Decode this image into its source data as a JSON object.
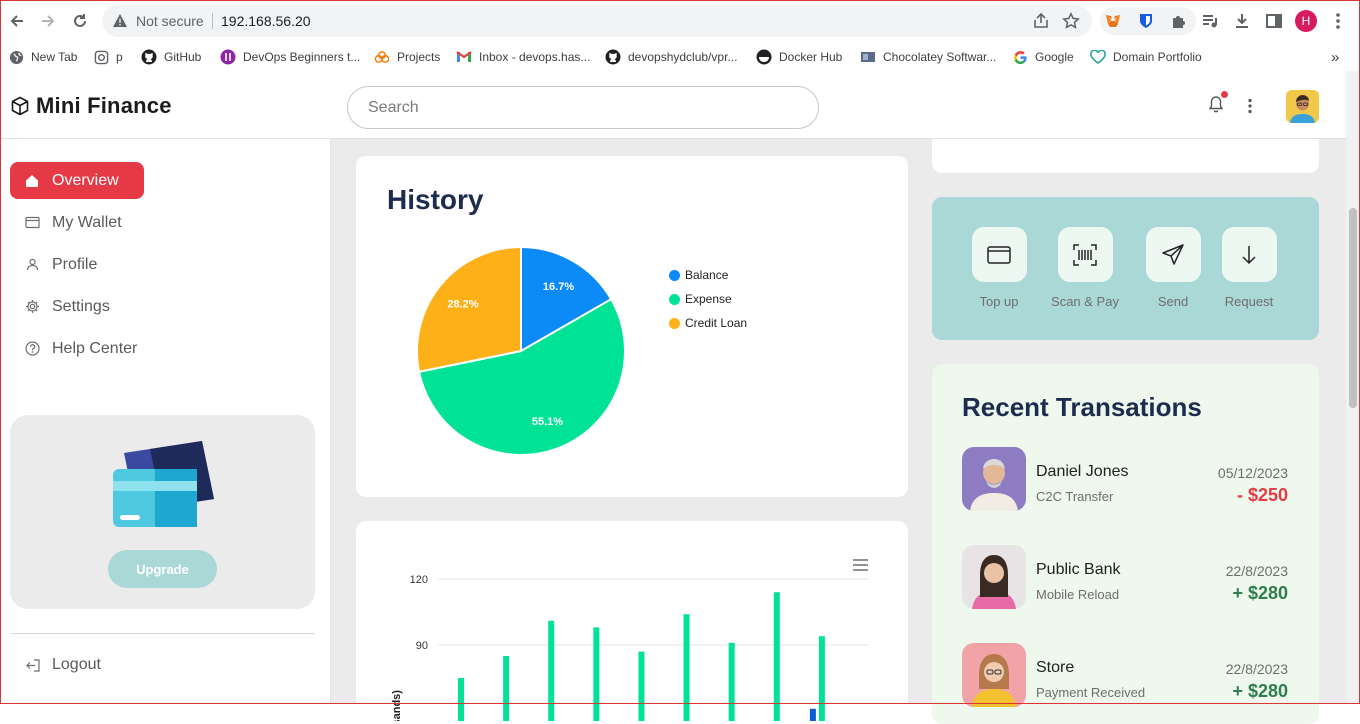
{
  "browser": {
    "security_text": "Not secure",
    "url": "192.168.56.20",
    "profile_initial": "H",
    "bookmarks": [
      {
        "label": "New Tab",
        "icon": "globe-icon"
      },
      {
        "label": "p",
        "icon": "page-icon"
      },
      {
        "label": "GitHub",
        "icon": "github-icon"
      },
      {
        "label": "DevOps Beginners t...",
        "icon": "purple-circle-icon"
      },
      {
        "label": "Projects",
        "icon": "cloud-icon"
      },
      {
        "label": "Inbox - devops.has...",
        "icon": "gmail-icon"
      },
      {
        "label": "devopshydclub/vpr...",
        "icon": "github-icon"
      },
      {
        "label": "Docker Hub",
        "icon": "docker-icon"
      },
      {
        "label": "Chocolatey Softwar...",
        "icon": "chocolatey-icon"
      },
      {
        "label": "Google",
        "icon": "google-icon"
      },
      {
        "label": "Domain Portfolio",
        "icon": "heart-icon"
      }
    ],
    "more_bookmarks": "»"
  },
  "app": {
    "name": "Mini Finance",
    "search_placeholder": "Search"
  },
  "sidebar": {
    "items": [
      {
        "label": "Overview",
        "icon": "home-icon",
        "active": true
      },
      {
        "label": "My Wallet",
        "icon": "wallet-icon",
        "active": false
      },
      {
        "label": "Profile",
        "icon": "user-icon",
        "active": false
      },
      {
        "label": "Settings",
        "icon": "gear-icon",
        "active": false
      },
      {
        "label": "Help Center",
        "icon": "question-icon",
        "active": false
      }
    ],
    "upgrade_label": "Upgrade",
    "logout_label": "Logout"
  },
  "history": {
    "title": "History"
  },
  "chart_data": [
    {
      "type": "pie",
      "title": "History",
      "categories": [
        "Balance",
        "Expense",
        "Credit Loan"
      ],
      "values": [
        16.7,
        55.1,
        28.2
      ],
      "labels": [
        "16.7%",
        "55.1%",
        "28.2%"
      ],
      "colors": [
        "#0b8af8",
        "#00e396",
        "#feb019"
      ],
      "legend": "right"
    },
    {
      "type": "bar",
      "ylabel": "(thousands)",
      "yticks": [
        90,
        120
      ],
      "ylim": [
        60,
        125
      ],
      "series": [
        {
          "color": "#00e396",
          "values": [
            75,
            85,
            101,
            98,
            87,
            104,
            91,
            114,
            94
          ]
        },
        {
          "color": "#0b5cd6",
          "values": [
            null,
            null,
            null,
            null,
            null,
            null,
            null,
            null,
            61
          ]
        }
      ],
      "menu_icon": "hamburger-icon"
    }
  ],
  "quick_actions": [
    {
      "label": "Top up",
      "icon": "card-icon"
    },
    {
      "label": "Scan & Pay",
      "icon": "barcode-icon"
    },
    {
      "label": "Send",
      "icon": "send-icon"
    },
    {
      "label": "Request",
      "icon": "arrow-down-icon"
    }
  ],
  "transactions": {
    "title": "Recent Transations",
    "items": [
      {
        "name": "Daniel Jones",
        "type": "C2C Transfer",
        "date": "05/12/2023",
        "amount": "- $250",
        "direction": "out"
      },
      {
        "name": "Public Bank",
        "type": "Mobile Reload",
        "date": "22/8/2023",
        "amount": "+ $280",
        "direction": "in"
      },
      {
        "name": "Store",
        "type": "Payment Received",
        "date": "22/8/2023",
        "amount": "+ $280",
        "direction": "in"
      }
    ]
  }
}
